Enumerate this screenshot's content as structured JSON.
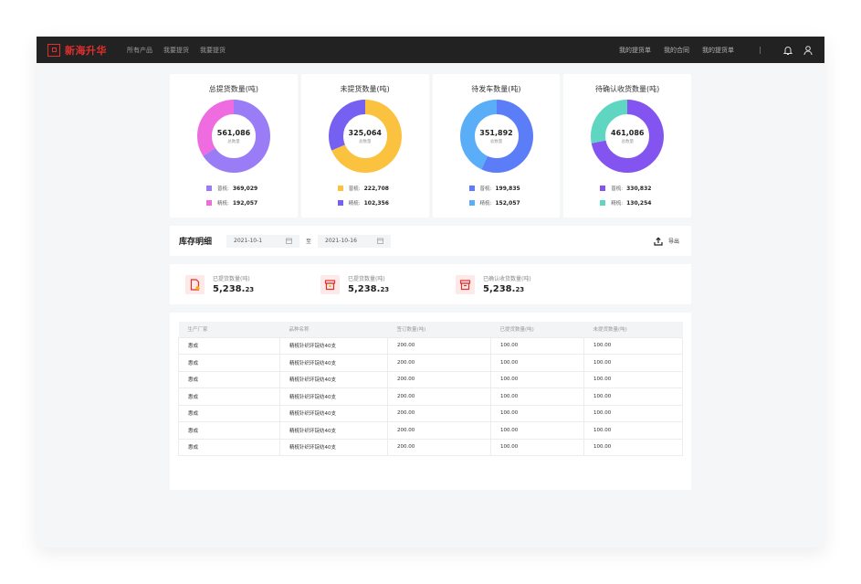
{
  "brand": {
    "name": "新海升华"
  },
  "nav": {
    "left": [
      "所有产品",
      "我要提货",
      "我要提货"
    ],
    "right": [
      "我的提货单",
      "我的合同",
      "我的提货单"
    ]
  },
  "topbar_icons": [
    "bell-icon",
    "user-icon"
  ],
  "cards": [
    {
      "title": "总提货数量(吨)",
      "total": "561,086",
      "total_label": "总数量",
      "legend": [
        {
          "label": "普梳:",
          "value": "369,029",
          "color": "#9a7cf7"
        },
        {
          "label": "精梳:",
          "value": "192,057",
          "color": "#ee6ce0"
        }
      ],
      "fractions": [
        0.658,
        0.342
      ]
    },
    {
      "title": "未提货数量(吨)",
      "total": "325,064",
      "total_label": "总数量",
      "legend": [
        {
          "label": "普梳:",
          "value": "222,708",
          "color": "#fbc23f"
        },
        {
          "label": "精梳:",
          "value": "102,356",
          "color": "#7660f2"
        }
      ],
      "fractions": [
        0.685,
        0.315
      ]
    },
    {
      "title": "待发车数量(吨)",
      "total": "351,892",
      "total_label": "总数量",
      "legend": [
        {
          "label": "普梳:",
          "value": "199,835",
          "color": "#5b7df8"
        },
        {
          "label": "精梳:",
          "value": "152,057",
          "color": "#5aaef7"
        }
      ],
      "fractions": [
        0.568,
        0.432
      ]
    },
    {
      "title": "待确认收货数量(吨)",
      "total": "461,086",
      "total_label": "总数量",
      "legend": [
        {
          "label": "普梳:",
          "value": "330,832",
          "color": "#8354f0"
        },
        {
          "label": "精梳:",
          "value": "130,254",
          "color": "#5fd6c2"
        }
      ],
      "fractions": [
        0.718,
        0.282
      ]
    }
  ],
  "filter": {
    "title": "库存明细",
    "start_date": "2021-10-1",
    "separator": "至",
    "end_date": "2021-10-16",
    "export_label": "导出"
  },
  "stats": [
    {
      "label": "已提货数量(吨)",
      "value_main": "5,238.",
      "value_dec": "23",
      "icon": "document-icon"
    },
    {
      "label": "已提货数量(吨)",
      "value_main": "5,238.",
      "value_dec": "23",
      "icon": "box-icon"
    },
    {
      "label": "已确认收货数量(吨)",
      "value_main": "5,238.",
      "value_dec": "23",
      "icon": "archive-icon"
    }
  ],
  "table": {
    "columns": [
      "生产厂家",
      "品种名称",
      "签订数量(吨)",
      "已提货数量(吨)",
      "未提货数量(吨)"
    ],
    "rows": [
      [
        "惠成",
        "精梳针织环锭纺40支",
        "200.00",
        "100.00",
        "100.00"
      ],
      [
        "惠成",
        "精梳针织环锭纺40支",
        "200.00",
        "100.00",
        "100.00"
      ],
      [
        "惠成",
        "精梳针织环锭纺40支",
        "200.00",
        "100.00",
        "100.00"
      ],
      [
        "惠成",
        "精梳针织环锭纺40支",
        "200.00",
        "100.00",
        "100.00"
      ],
      [
        "惠成",
        "精梳针织环锭纺40支",
        "200.00",
        "100.00",
        "100.00"
      ],
      [
        "惠成",
        "精梳针织环锭纺40支",
        "200.00",
        "100.00",
        "100.00"
      ],
      [
        "惠成",
        "精梳针织环锭纺40支",
        "200.00",
        "100.00",
        "100.00"
      ]
    ]
  }
}
